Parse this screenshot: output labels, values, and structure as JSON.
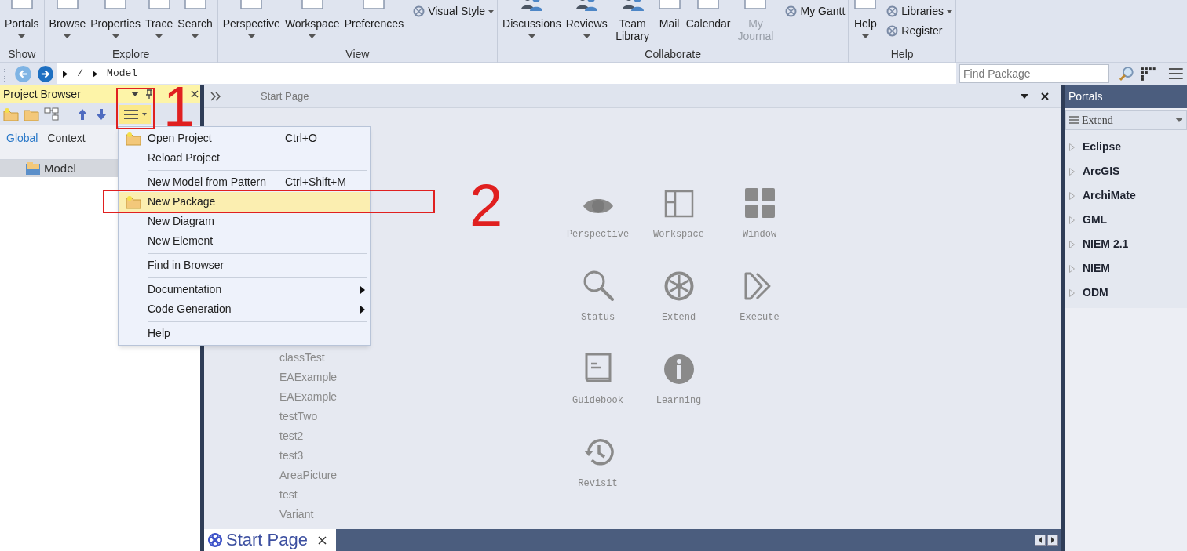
{
  "ribbon": {
    "groups": [
      {
        "label": "Show",
        "items": [
          {
            "kind": "large",
            "label": "Portals",
            "dropdown": true,
            "disabled": false
          }
        ]
      },
      {
        "label": "Explore",
        "items": [
          {
            "kind": "large",
            "label": "Browse",
            "dropdown": true,
            "disabled": false
          },
          {
            "kind": "large",
            "label": "Properties",
            "dropdown": true,
            "disabled": false
          },
          {
            "kind": "large",
            "label": "Trace",
            "dropdown": true,
            "disabled": false
          },
          {
            "kind": "large",
            "label": "Search",
            "dropdown": true,
            "disabled": false
          }
        ]
      },
      {
        "label": "View",
        "items": [
          {
            "kind": "large",
            "label": "Perspective",
            "dropdown": true,
            "disabled": false
          },
          {
            "kind": "large",
            "label": "Workspace",
            "dropdown": true,
            "disabled": false
          },
          {
            "kind": "large",
            "label": "Preferences",
            "dropdown": false,
            "disabled": false
          },
          {
            "kind": "small",
            "label": "Visual Style",
            "dropdown": true,
            "disabled": false
          }
        ]
      },
      {
        "label": "Collaborate",
        "items": [
          {
            "kind": "large",
            "label": "Discussions",
            "dropdown": true,
            "disabled": false
          },
          {
            "kind": "large",
            "label": "Reviews",
            "dropdown": true,
            "disabled": false
          },
          {
            "kind": "large",
            "label": "Team Library",
            "dropdown": false,
            "disabled": false
          },
          {
            "kind": "large",
            "label": "Mail",
            "dropdown": false,
            "disabled": false
          },
          {
            "kind": "large",
            "label": "Calendar",
            "dropdown": false,
            "disabled": false
          },
          {
            "kind": "large",
            "label": "My Journal",
            "dropdown": false,
            "disabled": true
          },
          {
            "kind": "small",
            "label": "My Gantt",
            "dropdown": false,
            "disabled": false
          }
        ]
      },
      {
        "label": "Help",
        "items": [
          {
            "kind": "large",
            "label": "Help",
            "dropdown": true,
            "disabled": false
          },
          {
            "kind": "small",
            "label": "Libraries",
            "dropdown": true,
            "disabled": false
          },
          {
            "kind": "small",
            "label": "Register",
            "dropdown": false,
            "disabled": false
          }
        ]
      }
    ]
  },
  "nav": {
    "breadcrumb": [
      "/",
      "Model"
    ],
    "search": {
      "placeholder": "Find Package"
    }
  },
  "project_browser": {
    "title": "Project Browser",
    "tabs": [
      {
        "label": "Global",
        "selected": true
      },
      {
        "label": "Context",
        "selected": false
      }
    ],
    "tree": [
      {
        "label": "Model",
        "selected": true
      }
    ]
  },
  "context_menu": {
    "items": [
      {
        "kind": "item",
        "label": "Open Project",
        "shortcut": "Ctrl+O",
        "icon": true,
        "submenu": false,
        "selected": false
      },
      {
        "kind": "item",
        "label": "Reload Project",
        "icon": false,
        "submenu": false,
        "selected": false
      },
      {
        "kind": "separator"
      },
      {
        "kind": "item",
        "label": "New Model from Pattern",
        "shortcut": "Ctrl+Shift+M",
        "icon": false,
        "submenu": false,
        "selected": false
      },
      {
        "kind": "item",
        "label": "New Package",
        "icon": true,
        "submenu": false,
        "selected": true
      },
      {
        "kind": "item",
        "label": "New Diagram",
        "icon": false,
        "submenu": false,
        "selected": false
      },
      {
        "kind": "item",
        "label": "New Element",
        "icon": false,
        "submenu": false,
        "selected": false
      },
      {
        "kind": "separator"
      },
      {
        "kind": "item",
        "label": "Find in Browser",
        "icon": false,
        "submenu": false,
        "selected": false
      },
      {
        "kind": "separator"
      },
      {
        "kind": "item",
        "label": "Documentation",
        "icon": false,
        "submenu": true,
        "selected": false
      },
      {
        "kind": "item",
        "label": "Code Generation",
        "icon": false,
        "submenu": true,
        "selected": false
      },
      {
        "kind": "separator"
      },
      {
        "kind": "item",
        "label": "Help",
        "icon": false,
        "submenu": false,
        "selected": false
      }
    ]
  },
  "start_page": {
    "title": "Start Page",
    "recent": [
      "classTest",
      "EAExample",
      "EAExample",
      "testTwo",
      "test2",
      "test3",
      "AreaPicture",
      "test",
      "Variant"
    ],
    "tile_rows": [
      [
        {
          "label": "Perspective"
        },
        {
          "label": "Workspace"
        },
        {
          "label": "Window"
        }
      ],
      [
        {
          "label": "Status"
        },
        {
          "label": "Extend"
        },
        {
          "label": "Execute"
        }
      ],
      [
        {
          "label": "Guidebook"
        },
        {
          "label": "Learning"
        }
      ],
      [
        {
          "label": "Revisit"
        }
      ]
    ],
    "document_tab": "Start Page"
  },
  "portals": {
    "title": "Portals",
    "selector": "Extend",
    "items": [
      "Eclipse",
      "ArcGIS",
      "ArchiMate",
      "GML",
      "NIEM 2.1",
      "NIEM",
      "ODM"
    ]
  },
  "annotations": [
    {
      "label": "1"
    },
    {
      "label": "2"
    }
  ]
}
